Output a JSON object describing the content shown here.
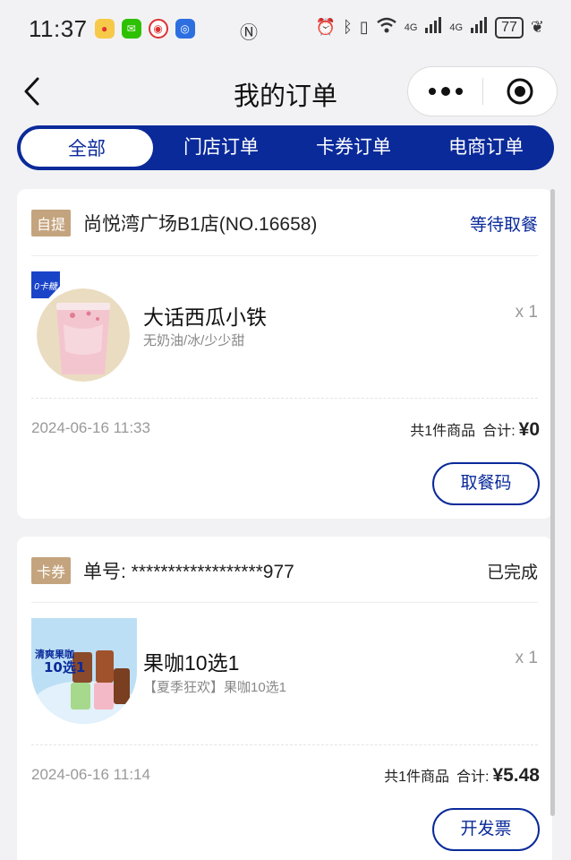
{
  "status_bar": {
    "time": "11:37",
    "battery": "77",
    "net1": "4G",
    "net2": "4G"
  },
  "nav": {
    "title": "我的订单"
  },
  "tabs": [
    {
      "label": "全部",
      "active": true
    },
    {
      "label": "门店订单",
      "active": false
    },
    {
      "label": "卡券订单",
      "active": false
    },
    {
      "label": "电商订单",
      "active": false
    }
  ],
  "orders": [
    {
      "tag": "自提",
      "store": "尚悦湾广场B1店(NO.16658)",
      "status": "等待取餐",
      "badge": "0卡糖",
      "product_name": "大话西瓜小铁",
      "product_spec": "无奶油/冰/少少甜",
      "qty": "x 1",
      "date": "2024-06-16 11:33",
      "count_label": "共1件商品",
      "total_label": "合计:",
      "total_amount": "¥0",
      "action": "取餐码"
    },
    {
      "tag": "卡券",
      "store": "单号: ******************977",
      "status": "已完成",
      "product_name": "果咖10选1",
      "product_spec": "【夏季狂欢】果咖10选1",
      "qty": "x 1",
      "date": "2024-06-16 11:14",
      "count_label": "共1件商品",
      "total_label": "合计:",
      "total_amount": "¥5.48",
      "action": "开发票",
      "img_text": "清爽果咖10选1"
    }
  ],
  "colors": {
    "brand_blue": "#0a2a9a",
    "tag_gold": "#c4a47e"
  }
}
